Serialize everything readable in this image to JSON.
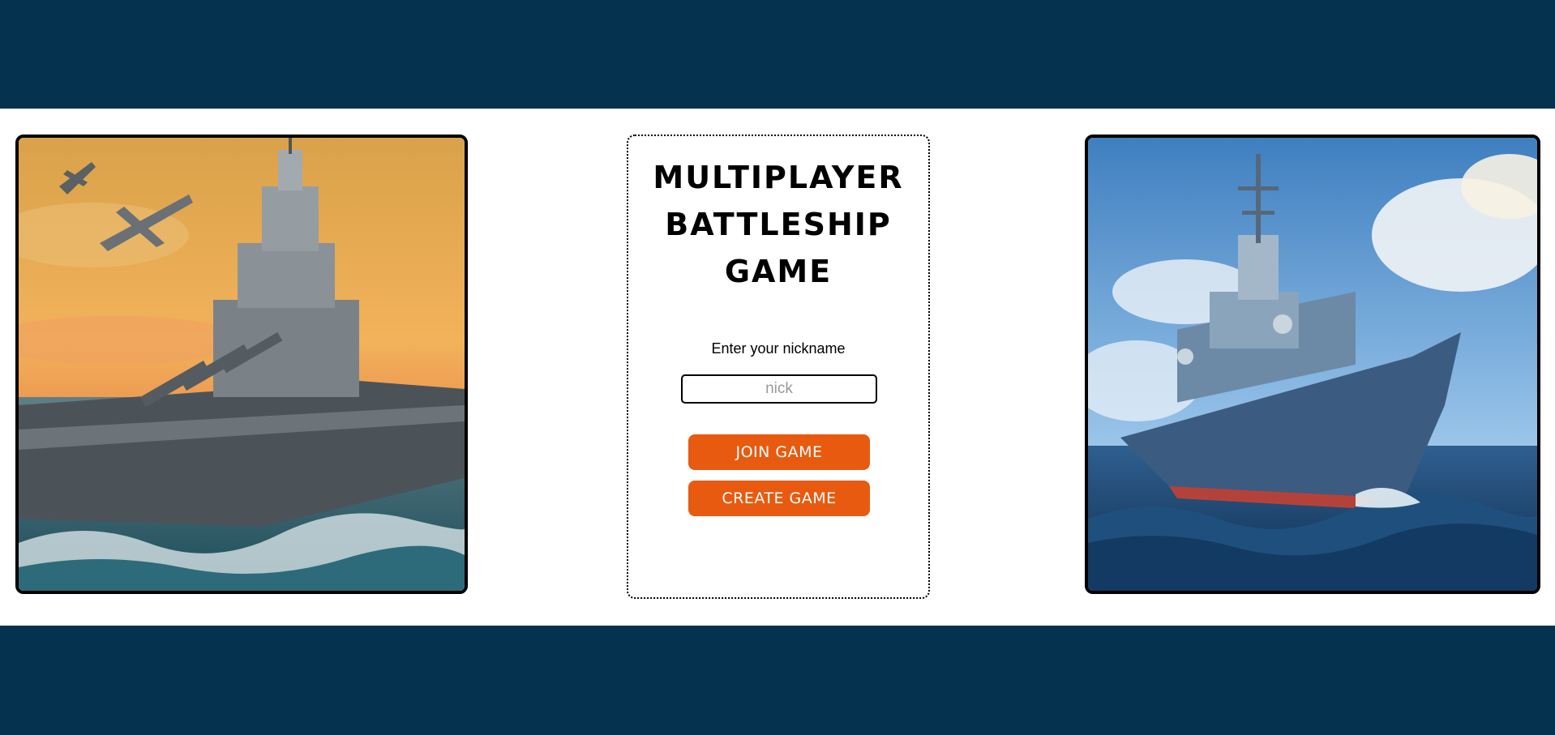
{
  "header": {},
  "images": {
    "left": {
      "icon": "battleship-sunset-illustration"
    },
    "right": {
      "icon": "warship-ocean-illustration"
    }
  },
  "card": {
    "title": "MULTIPLAYER\nBATTLESHIP\nGAME",
    "nickname_label": "Enter your nickname",
    "nickname_input": {
      "value": "",
      "placeholder": "nick"
    },
    "join_label": "JOIN GAME",
    "create_label": "CREATE GAME"
  },
  "colors": {
    "band": "#05324f",
    "button": "#e85a10",
    "button_text": "#ffffff"
  }
}
